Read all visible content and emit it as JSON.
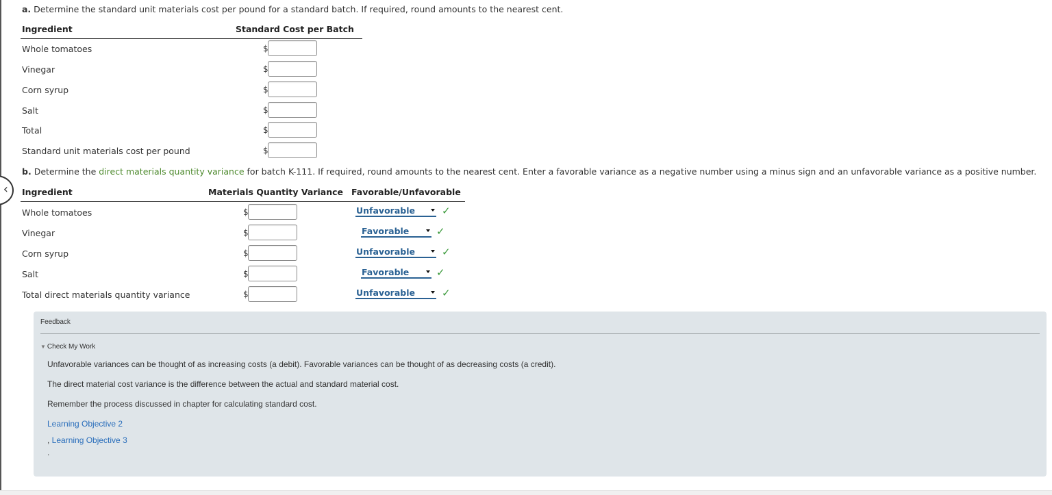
{
  "part_a": {
    "label": "a.",
    "instruction": "Determine the standard unit materials cost per pound for a standard batch. If required, round amounts to the nearest cent.",
    "col_ingredient": "Ingredient",
    "col_cost": "Standard Cost per Batch",
    "currency_symbol": "$",
    "rows": [
      {
        "label": "Whole tomatoes",
        "value": ""
      },
      {
        "label": "Vinegar",
        "value": ""
      },
      {
        "label": "Corn syrup",
        "value": ""
      },
      {
        "label": "Salt",
        "value": ""
      },
      {
        "label": "Total",
        "value": ""
      },
      {
        "label": "Standard unit materials cost per pound",
        "value": ""
      }
    ]
  },
  "part_b": {
    "label": "b.",
    "instruction_pre": "Determine the",
    "instruction_term": "direct materials quantity variance",
    "instruction_post": "for batch K-111. If required, round amounts to the nearest cent. Enter a favorable variance as a negative number using a minus sign and an unfavorable variance as a positive number.",
    "col_ingredient": "Ingredient",
    "col_variance": "Materials Quantity Variance",
    "col_fav": "Favorable/Unfavorable",
    "currency_symbol": "$",
    "check_mark": "✓",
    "rows": [
      {
        "label": "Whole tomatoes",
        "value": "",
        "selection": "Unfavorable",
        "correct": true
      },
      {
        "label": "Vinegar",
        "value": "",
        "selection": "Favorable",
        "correct": true
      },
      {
        "label": "Corn syrup",
        "value": "",
        "selection": "Unfavorable",
        "correct": true
      },
      {
        "label": "Salt",
        "value": "",
        "selection": "Favorable",
        "correct": true
      },
      {
        "label": "Total direct materials quantity variance",
        "value": "",
        "selection": "Unfavorable",
        "correct": true
      }
    ]
  },
  "feedback": {
    "title": "Feedback",
    "toggle_label": "Check My Work",
    "paragraphs": [
      "Unfavorable variances can be thought of as increasing costs (a debit). Favorable variances can be thought of as decreasing costs (a credit).",
      "The direct material cost variance is the difference between the actual and standard material cost.",
      "Remember the process discussed in chapter for calculating standard cost."
    ],
    "link1": "Learning Objective 2",
    "link2_prefix": ", ",
    "link2": "Learning Objective 3",
    "trailing": "."
  },
  "colors": {
    "term_green": "#4e8a2e",
    "select_blue": "#2a6193",
    "check_green": "#3c9a3c",
    "feedback_bg": "#dfe5e9",
    "link_blue": "#2a6ebb"
  }
}
